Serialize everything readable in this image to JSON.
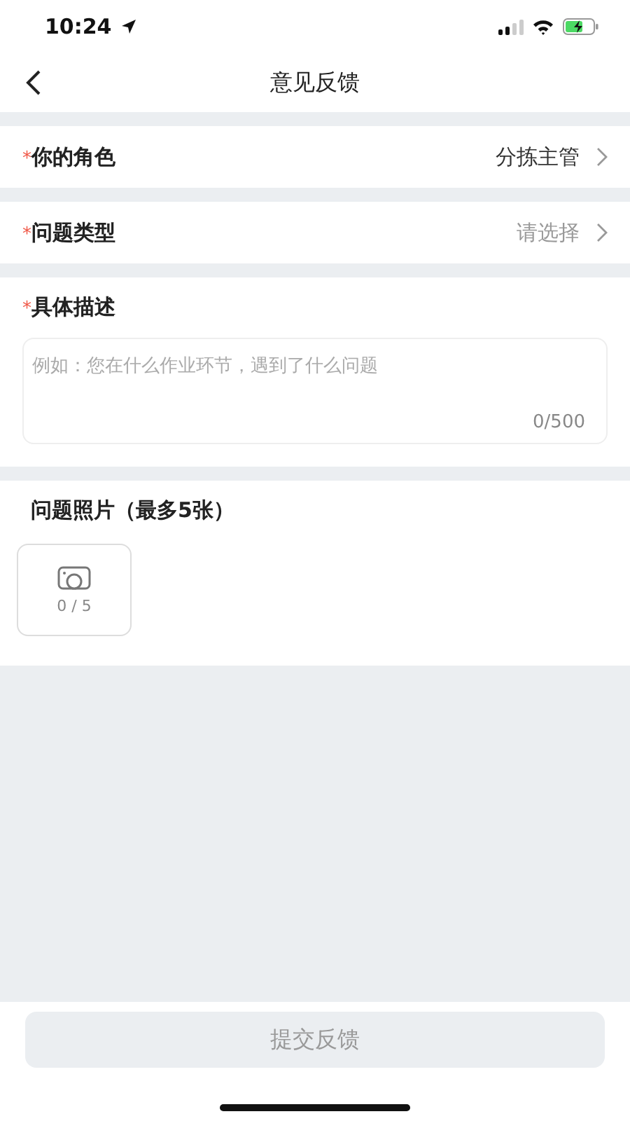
{
  "status_bar": {
    "time": "10:24"
  },
  "nav": {
    "title": "意见反馈"
  },
  "fields": [
    {
      "label": "你的角色",
      "required_mark": "*",
      "value": "分拣主管"
    },
    {
      "label": "问题类型",
      "required_mark": "*",
      "placeholder": "请选择"
    }
  ],
  "description": {
    "label": "具体描述",
    "required_mark": "*",
    "placeholder": "例如：您在什么作业环节，遇到了什么问题",
    "counter": "0/500"
  },
  "photos": {
    "title": "问题照片（最多5张）",
    "counter": "0 / 5"
  },
  "submit": {
    "label": "提交反馈",
    "disabled": true
  }
}
